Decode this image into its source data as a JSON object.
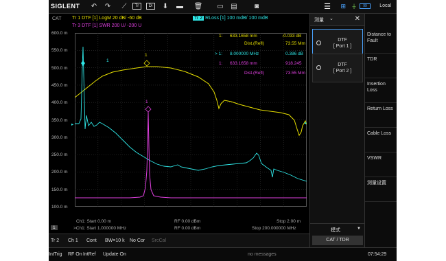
{
  "toolbar": {
    "brand": "SIGLENT",
    "local": "Local",
    "battery": "99"
  },
  "cat_label": "CAT",
  "traces": {
    "tr1": "Tr 1   DTF [1]  LogM  20 dB/  -60 dB",
    "tr3": "Tr 3   DTF [1]  SWR  200 U/  -200 U",
    "tr2_badge": "Tr 2",
    "tr2": " RLoss [1]   100 mdB/ 100 mdB"
  },
  "y_labels": [
    "600.0 m",
    "550.0 m",
    "500.0 m",
    "450.0 m",
    "400.0 m",
    "350.0 m",
    "300.0 m",
    "250.0 m",
    "200.0 m",
    "150.0 m",
    "100.0 m"
  ],
  "y_label_tr2": "100.0 m",
  "markers": {
    "m1_index": "1:",
    "m1_pos": "633.1658 mm",
    "m1_val": "-0.033 dB",
    "m1_dist_label": "Dist.(Refl)",
    "m1_dist": "73.55 Mm",
    "m2_index": "> 1:",
    "m2_pos": "8.000000 MHz",
    "m2_val": "0.386 dB",
    "m3_index": "1:",
    "m3_pos": "633.1658 mm",
    "m3_val": "918.245",
    "m3_dist_label": "Dist.(Refl)",
    "m3_dist": "73.55 Mm",
    "marker_num": "1"
  },
  "bottom": {
    "ch1_start": "Ch1: Start 0.00 m",
    "rf1": "RF 0.00 dBm",
    "stop1": "Stop 2.00 m",
    "ch1_start2": ">Ch1: Start 1.000000 MHz",
    "rf2": "RF 0.00 dBm",
    "stop2": "Stop 200.000000 MHz",
    "page": "1"
  },
  "status": {
    "tr": "Tr 2",
    "ch": "Ch 1",
    "cont": "Cont",
    "bw": "BW=10 k",
    "nocor": "No Cor",
    "srccal": "SrcCal"
  },
  "msgbar": {
    "inttrig": "IntTrig",
    "rfon": "RF On",
    "intref": "IntRef",
    "update": "Update On",
    "msg": "no messages",
    "time": "07:54:29"
  },
  "mid_panel": {
    "header": "测量",
    "port1_a": "DTF",
    "port1_b": "[ Port 1 ]",
    "port2_a": "DTF",
    "port2_b": "[ Port 2 ]",
    "mode": "模式",
    "cat_tdr": "CAT / TDR"
  },
  "softkeys": [
    "Distance to Fault",
    "TDR",
    "Insertion Loss",
    "Return Loss",
    "Cable Loss",
    "VSWR",
    "测量设置"
  ],
  "colors": {
    "tr1": "#e8e000",
    "tr2": "#2ee6e6",
    "tr3": "#e040e0"
  }
}
